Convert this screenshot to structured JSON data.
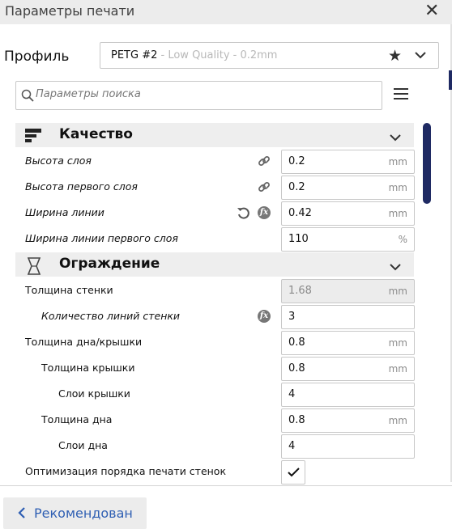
{
  "window": {
    "title": "Параметры печати",
    "close_glyph": "✕"
  },
  "profile": {
    "label": "Профиль",
    "name": "PETG #2",
    "quality": " - Low Quality - 0.2mm",
    "star_glyph": "★"
  },
  "search": {
    "placeholder": "Параметры поиска"
  },
  "sections": [
    {
      "title": "Качество",
      "icon": "quality-icon"
    },
    {
      "title": "Ограждение",
      "icon": "shell-icon"
    }
  ],
  "rows": [
    {
      "label": "Высота слоя",
      "value": "0.2",
      "unit": "mm",
      "icons": [
        "link-icon"
      ]
    },
    {
      "label": "Высота первого слоя",
      "value": "0.2",
      "unit": "mm",
      "icons": [
        "link-icon"
      ]
    },
    {
      "label": "Ширина линии",
      "value": "0.42",
      "unit": "mm",
      "icons": [
        "reset-icon",
        "function-icon"
      ]
    },
    {
      "label": "Ширина линии первого слоя",
      "value": "110",
      "unit": "%"
    },
    {
      "label": "Толщина стенки",
      "value": "1.68",
      "unit": "mm",
      "disabled": true
    },
    {
      "label": "Количество линий стенки",
      "value": "3",
      "unit": "",
      "icons": [
        "function-icon"
      ]
    },
    {
      "label": "Толщина дна/крышки",
      "value": "0.8",
      "unit": "mm"
    },
    {
      "label": "Толщина крышки",
      "value": "0.8",
      "unit": "mm"
    },
    {
      "label": "Слои крышки",
      "value": "4",
      "unit": ""
    },
    {
      "label": "Толщина дна",
      "value": "0.8",
      "unit": "mm"
    },
    {
      "label": "Слои дна",
      "value": "4",
      "unit": ""
    },
    {
      "label": "Оптимизация порядка печати стенок",
      "checked": true
    }
  ],
  "footer": {
    "recommended_label": "Рекомендован"
  },
  "colors": {
    "accent": "#1f2a63",
    "link": "#2f5fb3",
    "header_bg": "#ececec",
    "section_bg": "#eeeeee"
  }
}
